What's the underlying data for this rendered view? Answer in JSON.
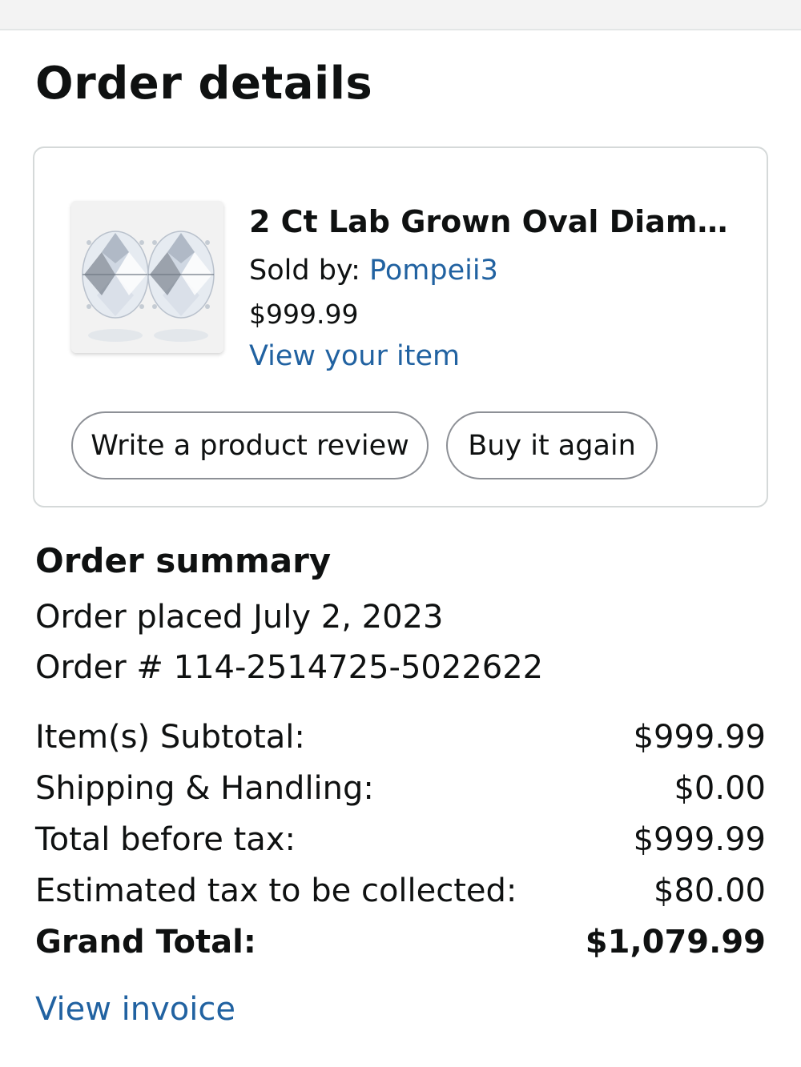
{
  "page": {
    "title": "Order details"
  },
  "item": {
    "title": "2 Ct Lab Grown Oval Diamo...",
    "sold_by_label": "Sold by: ",
    "seller": "Pompeii3",
    "price": "$999.99",
    "view_item_label": "View your item",
    "image_icon": "oval-diamond-earrings-image",
    "buttons": {
      "write_review": "Write a product review",
      "buy_again": "Buy it again"
    }
  },
  "summary": {
    "title": "Order summary",
    "order_placed": "Order placed July 2, 2023",
    "order_number": "Order # 114-2514725-5022622",
    "rows": [
      {
        "label": "Item(s) Subtotal:",
        "amount": "$999.99"
      },
      {
        "label": "Shipping & Handling:",
        "amount": "$0.00"
      },
      {
        "label": "Total before tax:",
        "amount": "$999.99"
      },
      {
        "label": "Estimated tax to be collected:",
        "amount": "$80.00"
      },
      {
        "label": "Grand Total:",
        "amount": "$1,079.99"
      }
    ],
    "view_invoice_label": "View invoice"
  },
  "colors": {
    "link": "#2162a1",
    "text": "#0f1111",
    "card_border": "#d5d9d9",
    "button_border": "#8d9096",
    "top_bar": "#f3f3f3"
  }
}
